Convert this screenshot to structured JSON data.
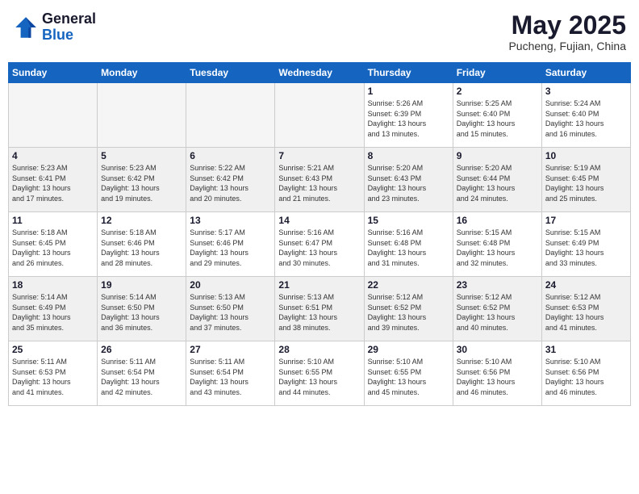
{
  "header": {
    "logo_general": "General",
    "logo_blue": "Blue",
    "month_year": "May 2025",
    "location": "Pucheng, Fujian, China"
  },
  "weekdays": [
    "Sunday",
    "Monday",
    "Tuesday",
    "Wednesday",
    "Thursday",
    "Friday",
    "Saturday"
  ],
  "weeks": [
    {
      "shaded": false,
      "days": [
        {
          "num": "",
          "info": ""
        },
        {
          "num": "",
          "info": ""
        },
        {
          "num": "",
          "info": ""
        },
        {
          "num": "",
          "info": ""
        },
        {
          "num": "1",
          "info": "Sunrise: 5:26 AM\nSunset: 6:39 PM\nDaylight: 13 hours\nand 13 minutes."
        },
        {
          "num": "2",
          "info": "Sunrise: 5:25 AM\nSunset: 6:40 PM\nDaylight: 13 hours\nand 15 minutes."
        },
        {
          "num": "3",
          "info": "Sunrise: 5:24 AM\nSunset: 6:40 PM\nDaylight: 13 hours\nand 16 minutes."
        }
      ]
    },
    {
      "shaded": true,
      "days": [
        {
          "num": "4",
          "info": "Sunrise: 5:23 AM\nSunset: 6:41 PM\nDaylight: 13 hours\nand 17 minutes."
        },
        {
          "num": "5",
          "info": "Sunrise: 5:23 AM\nSunset: 6:42 PM\nDaylight: 13 hours\nand 19 minutes."
        },
        {
          "num": "6",
          "info": "Sunrise: 5:22 AM\nSunset: 6:42 PM\nDaylight: 13 hours\nand 20 minutes."
        },
        {
          "num": "7",
          "info": "Sunrise: 5:21 AM\nSunset: 6:43 PM\nDaylight: 13 hours\nand 21 minutes."
        },
        {
          "num": "8",
          "info": "Sunrise: 5:20 AM\nSunset: 6:43 PM\nDaylight: 13 hours\nand 23 minutes."
        },
        {
          "num": "9",
          "info": "Sunrise: 5:20 AM\nSunset: 6:44 PM\nDaylight: 13 hours\nand 24 minutes."
        },
        {
          "num": "10",
          "info": "Sunrise: 5:19 AM\nSunset: 6:45 PM\nDaylight: 13 hours\nand 25 minutes."
        }
      ]
    },
    {
      "shaded": false,
      "days": [
        {
          "num": "11",
          "info": "Sunrise: 5:18 AM\nSunset: 6:45 PM\nDaylight: 13 hours\nand 26 minutes."
        },
        {
          "num": "12",
          "info": "Sunrise: 5:18 AM\nSunset: 6:46 PM\nDaylight: 13 hours\nand 28 minutes."
        },
        {
          "num": "13",
          "info": "Sunrise: 5:17 AM\nSunset: 6:46 PM\nDaylight: 13 hours\nand 29 minutes."
        },
        {
          "num": "14",
          "info": "Sunrise: 5:16 AM\nSunset: 6:47 PM\nDaylight: 13 hours\nand 30 minutes."
        },
        {
          "num": "15",
          "info": "Sunrise: 5:16 AM\nSunset: 6:48 PM\nDaylight: 13 hours\nand 31 minutes."
        },
        {
          "num": "16",
          "info": "Sunrise: 5:15 AM\nSunset: 6:48 PM\nDaylight: 13 hours\nand 32 minutes."
        },
        {
          "num": "17",
          "info": "Sunrise: 5:15 AM\nSunset: 6:49 PM\nDaylight: 13 hours\nand 33 minutes."
        }
      ]
    },
    {
      "shaded": true,
      "days": [
        {
          "num": "18",
          "info": "Sunrise: 5:14 AM\nSunset: 6:49 PM\nDaylight: 13 hours\nand 35 minutes."
        },
        {
          "num": "19",
          "info": "Sunrise: 5:14 AM\nSunset: 6:50 PM\nDaylight: 13 hours\nand 36 minutes."
        },
        {
          "num": "20",
          "info": "Sunrise: 5:13 AM\nSunset: 6:50 PM\nDaylight: 13 hours\nand 37 minutes."
        },
        {
          "num": "21",
          "info": "Sunrise: 5:13 AM\nSunset: 6:51 PM\nDaylight: 13 hours\nand 38 minutes."
        },
        {
          "num": "22",
          "info": "Sunrise: 5:12 AM\nSunset: 6:52 PM\nDaylight: 13 hours\nand 39 minutes."
        },
        {
          "num": "23",
          "info": "Sunrise: 5:12 AM\nSunset: 6:52 PM\nDaylight: 13 hours\nand 40 minutes."
        },
        {
          "num": "24",
          "info": "Sunrise: 5:12 AM\nSunset: 6:53 PM\nDaylight: 13 hours\nand 41 minutes."
        }
      ]
    },
    {
      "shaded": false,
      "days": [
        {
          "num": "25",
          "info": "Sunrise: 5:11 AM\nSunset: 6:53 PM\nDaylight: 13 hours\nand 41 minutes."
        },
        {
          "num": "26",
          "info": "Sunrise: 5:11 AM\nSunset: 6:54 PM\nDaylight: 13 hours\nand 42 minutes."
        },
        {
          "num": "27",
          "info": "Sunrise: 5:11 AM\nSunset: 6:54 PM\nDaylight: 13 hours\nand 43 minutes."
        },
        {
          "num": "28",
          "info": "Sunrise: 5:10 AM\nSunset: 6:55 PM\nDaylight: 13 hours\nand 44 minutes."
        },
        {
          "num": "29",
          "info": "Sunrise: 5:10 AM\nSunset: 6:55 PM\nDaylight: 13 hours\nand 45 minutes."
        },
        {
          "num": "30",
          "info": "Sunrise: 5:10 AM\nSunset: 6:56 PM\nDaylight: 13 hours\nand 46 minutes."
        },
        {
          "num": "31",
          "info": "Sunrise: 5:10 AM\nSunset: 6:56 PM\nDaylight: 13 hours\nand 46 minutes."
        }
      ]
    }
  ]
}
